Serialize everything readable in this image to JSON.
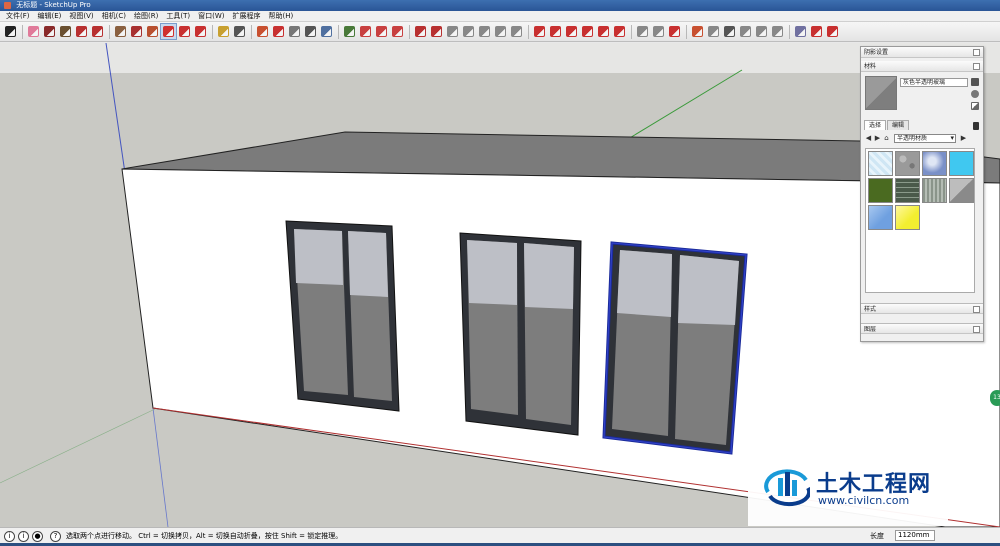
{
  "window": {
    "title": "无标题 - SketchUp Pro"
  },
  "menu": [
    "文件(F)",
    "编辑(E)",
    "视图(V)",
    "相机(C)",
    "绘图(R)",
    "工具(T)",
    "窗口(W)",
    "扩展程序",
    "帮助(H)"
  ],
  "toolbar": {
    "icons": [
      {
        "name": "select-arrow-icon",
        "color": "#222222"
      },
      {
        "name": "eraser-icon",
        "color": "#e07a9a"
      },
      {
        "name": "pencil-line-icon",
        "color": "#8a2a2a"
      },
      {
        "name": "rectangle-dropdown-icon",
        "color": "#6a5030"
      },
      {
        "name": "arc-icon",
        "color": "#b83030"
      },
      {
        "name": "arc-dropdown-icon",
        "color": "#b83030"
      },
      {
        "name": "push-pull-icon",
        "color": "#8a6040"
      },
      {
        "name": "offset-icon",
        "color": "#a83030"
      },
      {
        "name": "follow-me-icon",
        "color": "#b85030"
      },
      {
        "name": "move-icon",
        "color": "#d03030"
      },
      {
        "name": "rotate-icon",
        "color": "#c83030"
      },
      {
        "name": "scale-icon",
        "color": "#c83030"
      },
      {
        "name": "tape-measure-icon",
        "color": "#c8a030"
      },
      {
        "name": "text-icon",
        "color": "#555555"
      },
      {
        "name": "paint-bucket-icon",
        "color": "#c85030"
      },
      {
        "name": "orbit-icon",
        "color": "#c83030"
      },
      {
        "name": "pan-icon",
        "color": "#777777"
      },
      {
        "name": "zoom-icon",
        "color": "#555555"
      },
      {
        "name": "zoom-extents-icon",
        "color": "#5070a0"
      },
      {
        "name": "warehouse-icon",
        "color": "#4a7a3a"
      },
      {
        "name": "components-icon",
        "color": "#c84040"
      },
      {
        "name": "share-model-icon",
        "color": "#c84040"
      },
      {
        "name": "extension-icon",
        "color": "#c84040"
      },
      {
        "name": "sandbox-icon",
        "color": "#b83030"
      },
      {
        "name": "sandbox-scratch-icon",
        "color": "#b83030"
      },
      {
        "name": "smoove-icon",
        "color": "#888888"
      },
      {
        "name": "stamp-icon",
        "color": "#888888"
      },
      {
        "name": "drape-icon",
        "color": "#888888"
      },
      {
        "name": "add-detail-icon",
        "color": "#888888"
      },
      {
        "name": "flip-edge-icon",
        "color": "#888888"
      },
      {
        "name": "solid-tools-icon",
        "color": "#c83030"
      },
      {
        "name": "section-plane-icon",
        "color": "#c83030"
      },
      {
        "name": "dimension-icon",
        "color": "#c83030"
      },
      {
        "name": "protractor-icon",
        "color": "#c83030"
      },
      {
        "name": "axes-icon",
        "color": "#c83030"
      },
      {
        "name": "3d-text-icon",
        "color": "#c83030"
      },
      {
        "name": "walk-icon",
        "color": "#888888"
      },
      {
        "name": "look-around-icon",
        "color": "#888888"
      },
      {
        "name": "position-camera-icon",
        "color": "#c83030"
      },
      {
        "name": "shadow-icon",
        "color": "#c85030"
      },
      {
        "name": "fog-icon",
        "color": "#888888"
      },
      {
        "name": "edge-style-icon",
        "color": "#555555"
      },
      {
        "name": "face-style-icon",
        "color": "#888888"
      },
      {
        "name": "xray-icon",
        "color": "#888888"
      },
      {
        "name": "layers-icon",
        "color": "#888888"
      },
      {
        "name": "iso-view-icon",
        "color": "#7070a0"
      },
      {
        "name": "top-view-icon",
        "color": "#c83030"
      },
      {
        "name": "front-view-icon",
        "color": "#c83030"
      }
    ]
  },
  "tray": {
    "scenes_header": "阴影设置",
    "materials_header": "材料",
    "material_name": "灰色半透明玻璃",
    "tabs": [
      "选择",
      "编辑"
    ],
    "library": "半透明材质",
    "swatches": [
      {
        "name": "swatch-light-blue-pattern",
        "color": "#cfe6f4"
      },
      {
        "name": "swatch-gray-stucco",
        "color": "#9a9a9a"
      },
      {
        "name": "swatch-blue-sky",
        "color": "#7a90c8"
      },
      {
        "name": "swatch-cyan",
        "color": "#40c8f0"
      },
      {
        "name": "swatch-green",
        "color": "#4a6a20"
      },
      {
        "name": "swatch-dark-grid",
        "color": "#5a6a5a"
      },
      {
        "name": "swatch-gray-stripes",
        "color": "#909a90"
      },
      {
        "name": "swatch-gray-translucent",
        "color": "#8a8a8a"
      },
      {
        "name": "swatch-blue",
        "color": "#6fa0e0"
      },
      {
        "name": "swatch-yellow",
        "color": "#f2ee30"
      }
    ],
    "styles_header": "样式",
    "layers_header": "图层"
  },
  "status": {
    "text": "选取两个点进行移动。 Ctrl = 切换拷贝，Alt = 切换自动折叠，按住 Shift = 锁定推理。",
    "measure_label": "长度",
    "measure_value": "1120mm"
  },
  "watermark": {
    "title": "土木工程网",
    "url": "www.civilcn.com"
  },
  "colors": {
    "sky": "#cacac6",
    "ground": "#c8c8c0",
    "wall": "#ffffff",
    "roof": "#7a7a7a",
    "frame": "#2f3238",
    "glass_light": "#bcbec6",
    "glass_dark": "#7c7c7c",
    "selection": "#1a2a9a"
  }
}
